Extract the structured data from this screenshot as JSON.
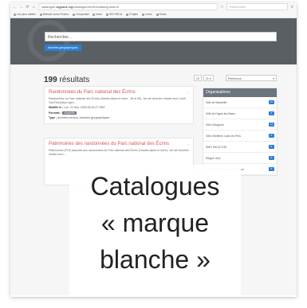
{
  "browser": {
    "url_prefix": "catalogue.",
    "url_domain": "sigpaca.org",
    "url_rest": "/catalogue/srv/fre/catalog.search",
    "search_placeholder": "Rechercher",
    "bookmarks": [
      "Les plus visités",
      "Débuter avec Firefox",
      "Geoportail",
      "Infos",
      "SIG PACA",
      "Projets",
      "Liens",
      "Outils"
    ]
  },
  "hero": {
    "search_placeholder": "Rechercher...",
    "chip_label": "données géographiques"
  },
  "results": {
    "count": "199",
    "count_label": "résultats",
    "pager": [
      "20",
      "21 ▾"
    ],
    "sort_label": "Pertinence"
  },
  "cards": [
    {
      "title": "Randonnées du Parc national des Écrins",
      "text": "Randonnées du Parc national des Écrins (Hautes-Alpes et Isère - 38 et 05). Jeu de données réalisé avec l'outil GeoTrek [https://gen...",
      "modified_label": "Modifié le :",
      "modified_value": "Lun. 21 Nov. 2018 09:42:27 GMT",
      "formats_label": "Formats :",
      "formats_value": "shapefile",
      "type_label": "Type :",
      "type_value": "données vecteur, données géographiques"
    },
    {
      "title": "Patrimoines des randonnées du Parc national des Écrins",
      "text": "Patrimoines (POI) associés aux randonnées du Parc national des Écrins (Hautes-Alpes et Isère). Jeu de données réalisé avec...",
      "modified_label": "",
      "modified_value": "",
      "formats_label": "",
      "formats_value": "",
      "type_label": "",
      "type_value": ""
    }
  ],
  "organisations": {
    "title": "Organisations",
    "items": [
      {
        "name": "Ville de Marseille",
        "count": "11"
      },
      {
        "name": "Ville de Digne-les-Bains",
        "count": "6"
      },
      {
        "name": "Ville d'Avignon",
        "count": "14"
      },
      {
        "name": "Ville d'Antibes Juan-les-Pins",
        "count": "5"
      },
      {
        "name": "SMO PACA THD",
        "count": "5"
      },
      {
        "name": "Région Sud",
        "count": "5"
      },
      {
        "name": "Provence-Alpes Agglomération",
        "count": "5"
      }
    ]
  },
  "overlay": {
    "lines": [
      "Catalogues",
      "« marque",
      "blanche »"
    ]
  }
}
